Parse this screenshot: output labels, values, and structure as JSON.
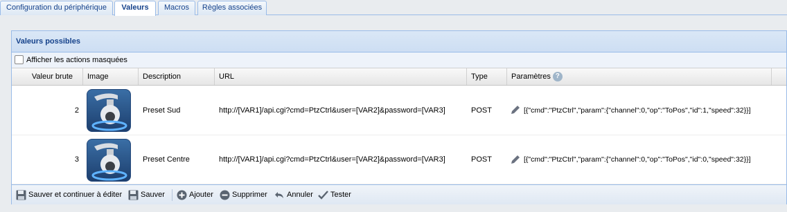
{
  "tabs": [
    {
      "label": "Configuration du périphérique",
      "active": false
    },
    {
      "label": "Valeurs",
      "active": true
    },
    {
      "label": "Macros",
      "active": false
    },
    {
      "label": "Règles associées",
      "active": false
    }
  ],
  "panel": {
    "title": "Valeurs possibles",
    "show_hidden_label": "Afficher les actions masquées",
    "show_hidden_checked": false
  },
  "grid": {
    "columns": [
      "Valeur brute",
      "Image",
      "Description",
      "URL",
      "Type",
      "Paramètres"
    ],
    "help_icon": "?",
    "rows": [
      {
        "raw": "2",
        "image": "ptz-camera-icon",
        "description": "Preset Sud",
        "url": "http://[VAR1]/api.cgi?cmd=PtzCtrl&user=[VAR2]&password=[VAR3]",
        "type": "POST",
        "params": "[{\"cmd\":\"PtzCtrl\",\"param\":{\"channel\":0,\"op\":\"ToPos\",\"id\":1,\"speed\":32}}]"
      },
      {
        "raw": "3",
        "image": "ptz-camera-icon",
        "description": "Preset Centre",
        "url": "http://[VAR1]/api.cgi?cmd=PtzCtrl&user=[VAR2]&password=[VAR3]",
        "type": "POST",
        "params": "[{\"cmd\":\"PtzCtrl\",\"param\":{\"channel\":0,\"op\":\"ToPos\",\"id\":0,\"speed\":32}}]"
      }
    ]
  },
  "toolbar": {
    "save_continue": "Sauver et continuer à éditer",
    "save": "Sauver",
    "add": "Ajouter",
    "delete": "Supprimer",
    "cancel": "Annuler",
    "test": "Tester"
  },
  "colors": {
    "accent": "#15428b",
    "border": "#99bbe8",
    "header_bg": "#dae7f6"
  }
}
